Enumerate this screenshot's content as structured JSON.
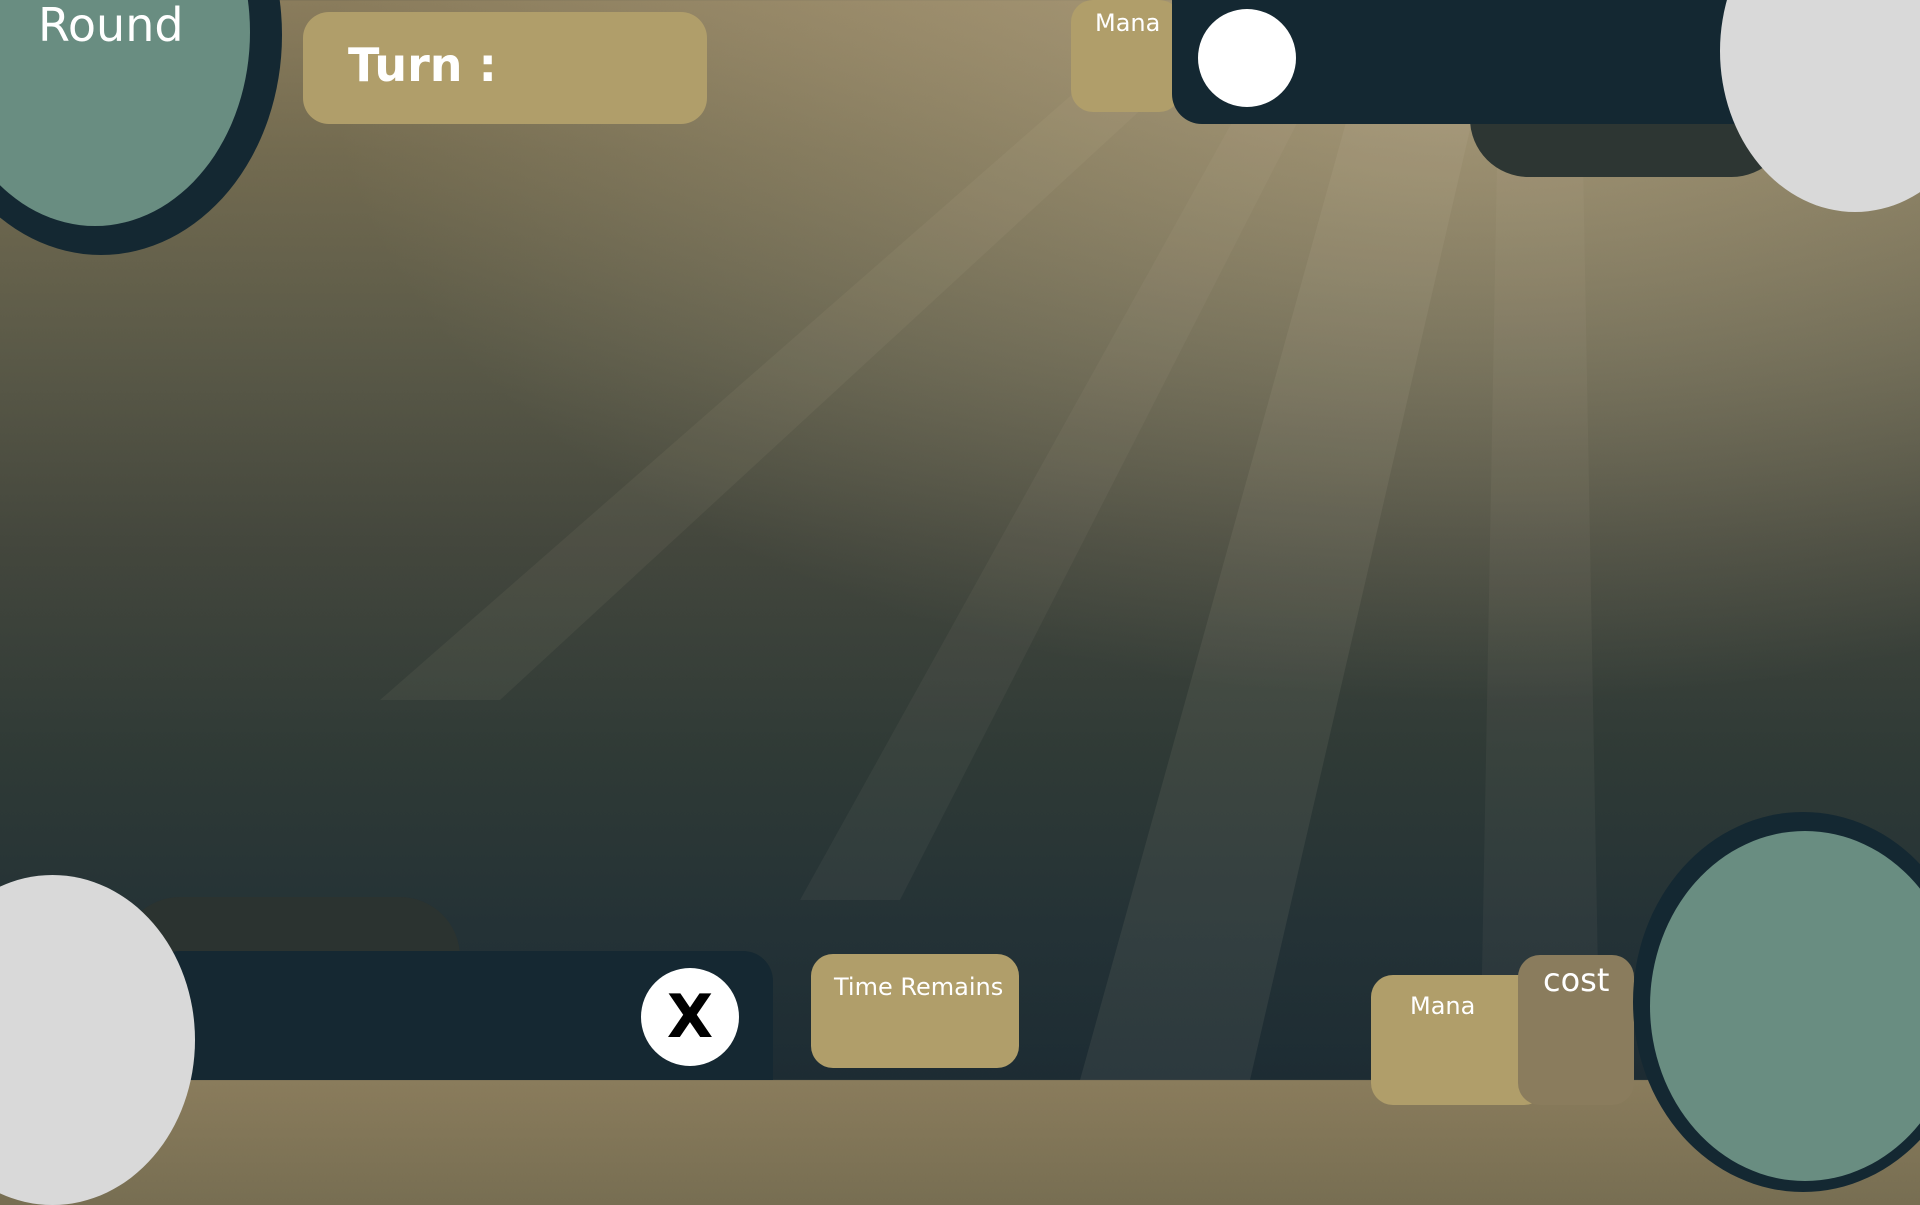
{
  "hud": {
    "round_label": "Round",
    "turn_label": "Turn :",
    "opponent_mana_label": "Mana",
    "time_label": "Time Remains",
    "mana_label": "Mana",
    "cost_label": "cost",
    "close_label": "X"
  },
  "colors": {
    "panel_gold": "#b09e6a",
    "panel_dark": "#142832",
    "cost_panel": "#8a7c5d",
    "deck_teal": "#698d81",
    "avatar_gray": "#d9d9d9"
  }
}
